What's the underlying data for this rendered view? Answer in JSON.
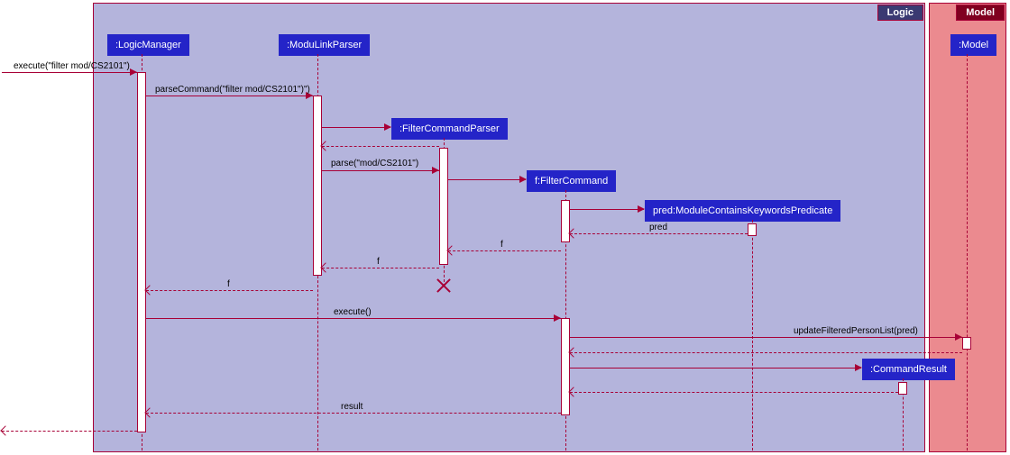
{
  "boxes": {
    "logic": {
      "title": "Logic"
    },
    "model": {
      "title": "Model"
    }
  },
  "participants": {
    "logicManager": ":LogicManager",
    "moduLinkParser": ":ModuLinkParser",
    "filterCommandParser": ":FilterCommandParser",
    "filterCommand": "f:FilterCommand",
    "predicate": "pred:ModuleContainsKeywordsPredicate",
    "commandResult": ":CommandResult",
    "model": ":Model"
  },
  "messages": {
    "m1": "execute(\"filter mod/CS2101\")",
    "m2": "parseCommand(\"filter mod/CS2101\")\")",
    "m3": "parse(\"mod/CS2101\")",
    "m4": "pred",
    "m5": "f",
    "m6": "f",
    "m7": "f",
    "m8": "execute()",
    "m9": "updateFilteredPersonList(pred)",
    "m10": "result"
  }
}
